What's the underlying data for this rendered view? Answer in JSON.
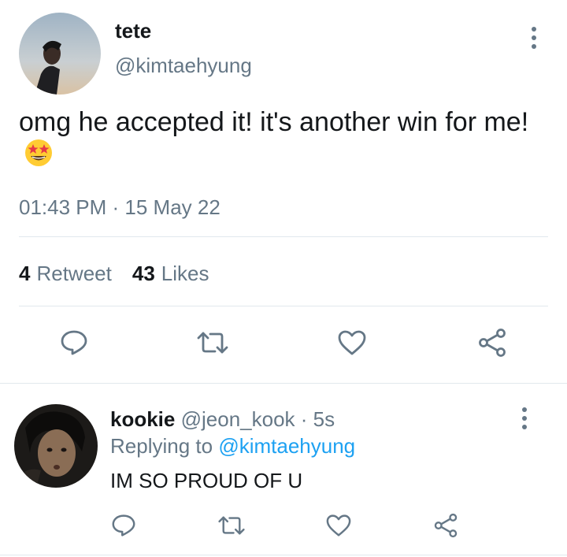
{
  "tweet": {
    "display_name": "tete",
    "handle": "@kimtaehyung",
    "text": "omg he accepted it! it's another win for me!",
    "emoji": "star-struck-emoji",
    "time": "01:43 PM",
    "date_sep": " · ",
    "date": "15 May 22",
    "retweet_count": "4",
    "retweet_label": "Retweet",
    "like_count": "43",
    "like_label": "Likes",
    "actions": [
      "reply-icon",
      "retweet-icon",
      "heart-icon",
      "share-icon"
    ]
  },
  "reply": {
    "display_name": "kookie",
    "handle": "@jeon_kook",
    "time_sep": " · ",
    "time": "5s",
    "replying_label": "Replying to",
    "replying_to": "@kimtaehyung",
    "text": "IM SO PROUD OF U",
    "actions": [
      "reply-icon",
      "retweet-icon",
      "heart-icon",
      "share-icon"
    ]
  },
  "colors": {
    "text": "#14171a",
    "secondary": "#657786",
    "link": "#1da1f2",
    "divider": "#e1e8ed"
  }
}
